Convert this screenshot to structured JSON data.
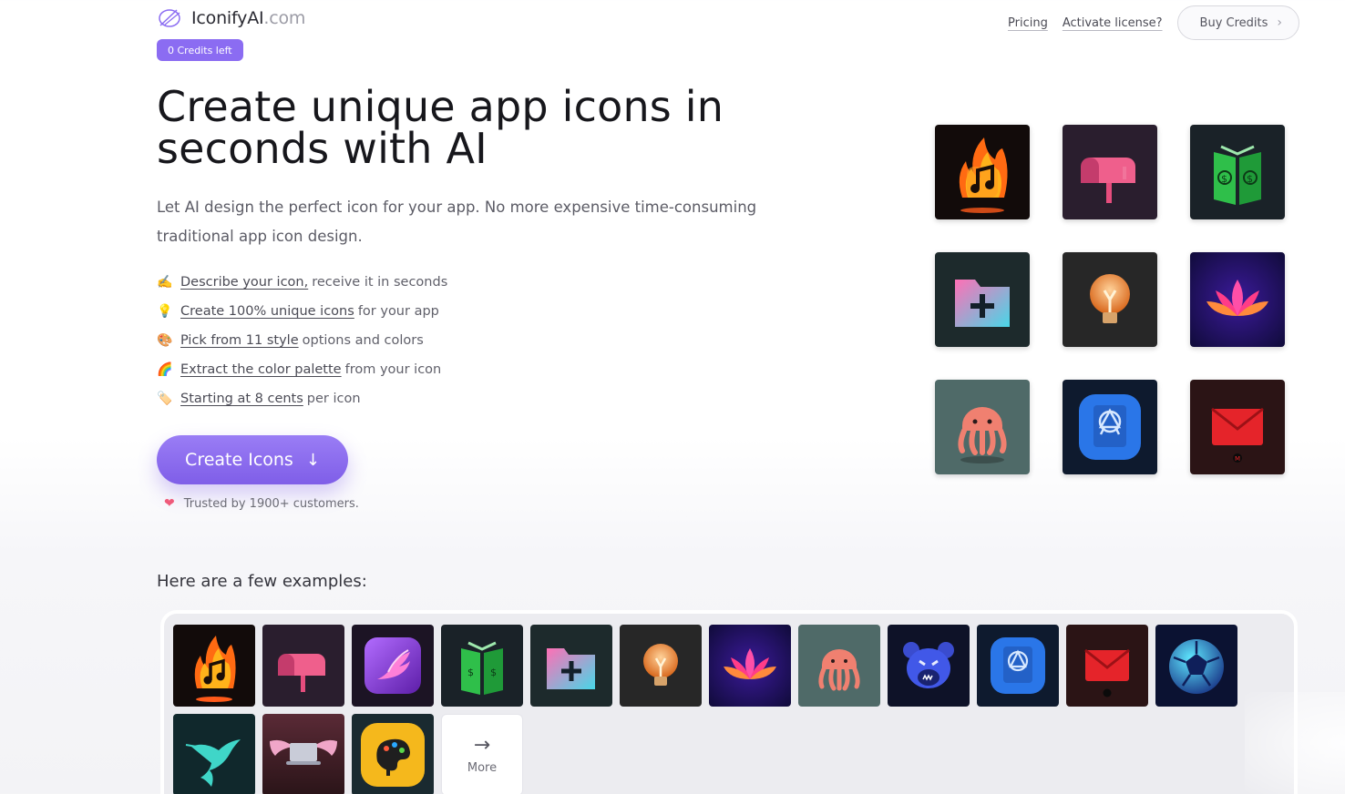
{
  "brand": {
    "name": "IconifyAI",
    "domain": ".com",
    "accent": "#8b6cf2"
  },
  "badge": {
    "credits": "0 Credits left"
  },
  "nav": {
    "pricing": "Pricing",
    "activate": "Activate license?",
    "buy": "Buy Credits"
  },
  "hero": {
    "title": "Create unique app icons in seconds with AI",
    "subtitle": "Let AI design the perfect icon for your app. No more expensive time-consuming traditional app icon design."
  },
  "features": [
    {
      "emoji": "✍️",
      "link": "Describe your icon,",
      "rest": "receive it in seconds"
    },
    {
      "emoji": "💡",
      "link": "Create 100% unique icons",
      "rest": "for your app"
    },
    {
      "emoji": "🎨",
      "link": "Pick from 11 style",
      "rest": "options and colors"
    },
    {
      "emoji": "🌈",
      "link": "Extract the color palette",
      "rest": "from your icon"
    },
    {
      "emoji": "🏷️",
      "link": "Starting at 8 cents",
      "rest": "per icon"
    }
  ],
  "cta": {
    "label": "Create Icons",
    "arrow": "↓"
  },
  "trusted": {
    "text": "Trusted by 1900+ customers."
  },
  "examples": {
    "label": "Here are a few examples:",
    "more": "More"
  },
  "icons": {
    "hero_grid": [
      "fire-music-icon",
      "mailbox-icon",
      "money-book-icon",
      "folder-plus-icon",
      "lightbulb-icon",
      "lotus-icon",
      "jellyfish-icon",
      "app-store-book-icon",
      "red-mail-icon"
    ],
    "examples_row": [
      "fire-music-icon",
      "mailbox-icon",
      "phoenix-icon",
      "money-book-icon",
      "folder-plus-icon",
      "lightbulb-icon",
      "lotus-icon",
      "jellyfish-icon",
      "bear-icon",
      "app-store-book-icon",
      "red-mail-icon",
      "soccer-ball-icon",
      "hummingbird-icon",
      "winged-laptop-icon",
      "paint-palette-icon"
    ]
  }
}
